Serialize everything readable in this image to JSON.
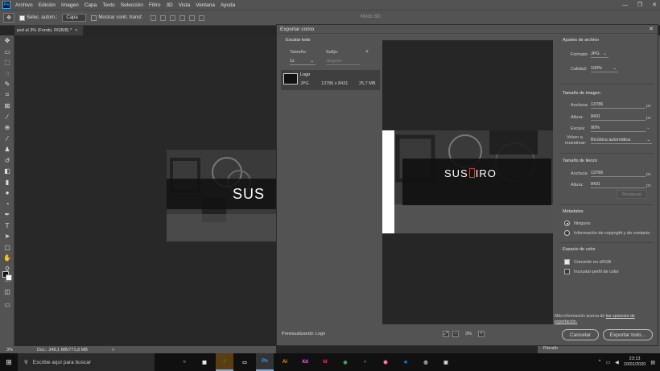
{
  "menubar": {
    "logo": "Ps",
    "items": [
      "Archivo",
      "Edición",
      "Imagen",
      "Capa",
      "Texto",
      "Selección",
      "Filtro",
      "3D",
      "Vista",
      "Ventana",
      "Ayuda"
    ]
  },
  "optbar": {
    "autoselect_label": "Selec. autom.:",
    "autoselect_value": "Capa",
    "transform_label": "Mostrar contr. transf.",
    "mode_3d": "Modo 3D:"
  },
  "doc_tab": {
    "title": "psd al 3% (Fondo, RGB/8) *",
    "close": "×"
  },
  "canvas": {
    "art_title": "SUS"
  },
  "statusbar": {
    "zoom": "3%",
    "doc_info": "Doc.: 348,1 MB/771,8 MB",
    "arrow": ">"
  },
  "parrafo": "Párrafo",
  "dialog": {
    "title": "Exportar como",
    "close": "✕",
    "left": {
      "heading": "Escalar todo",
      "size_label": "Tamaño:",
      "suffix_label": "Sufijo:",
      "add": "+",
      "size_value": "1x",
      "suffix_placeholder": "ninguno",
      "asset_name": "Logo",
      "asset_format": "JPG",
      "asset_dims": "13786 x 8431",
      "asset_size": "25,7 MB",
      "preview_label": "Previsualizando:",
      "preview_name": "Logo"
    },
    "preview": {
      "title_left": "SUS",
      "title_right": "IRO"
    },
    "zoom": {
      "value": "3%",
      "minus": "−",
      "plus": "+"
    },
    "right": {
      "file_settings_heading": "Ajustes de archivo",
      "format_label": "Formato:",
      "format_value": "JPG",
      "quality_label": "Calidad:",
      "quality_value": "100%",
      "image_size_heading": "Tamaño de imagen",
      "width_label": "Anchura:",
      "width_value": "13786",
      "height_label": "Altura:",
      "height_value": "8431",
      "scale_label": "Escala:",
      "scale_value": "90%",
      "resample_label_1": "Volver a",
      "resample_label_2": "muestrear:",
      "resample_value": "Bicúbica automática",
      "unit": "px",
      "canvas_size_heading": "Tamaño de lienzo",
      "canvas_width_value": "13786",
      "canvas_height_value": "8431",
      "restore_button": "Restaurar",
      "metadata_heading": "Metadatos",
      "metadata_none": "Ninguno",
      "metadata_copyright": "Información de copyright y de contacto",
      "color_space_heading": "Espacio de color",
      "convert_srgb": "Convertir en sRGB",
      "embed_profile": "Incrustar perfil de color"
    },
    "more_info": "Más información acerca de ",
    "more_info_link": "las opciones de exportación.",
    "cancel_button": "Cancelar",
    "export_button": "Exportar todo..."
  },
  "taskbar": {
    "search_placeholder": "Escribe aquí para buscar",
    "apps": [
      "○",
      "▦",
      "♫",
      "▭",
      "Ps",
      "Ai",
      "Xd",
      "Id",
      "◉",
      "◐",
      "⬢",
      "❖",
      "◎",
      "▣"
    ],
    "time": "23:13",
    "date": "10/01/2020"
  },
  "colors": {
    "accent_red": "#d23a2a",
    "ps_blue": "#31a8ff"
  }
}
